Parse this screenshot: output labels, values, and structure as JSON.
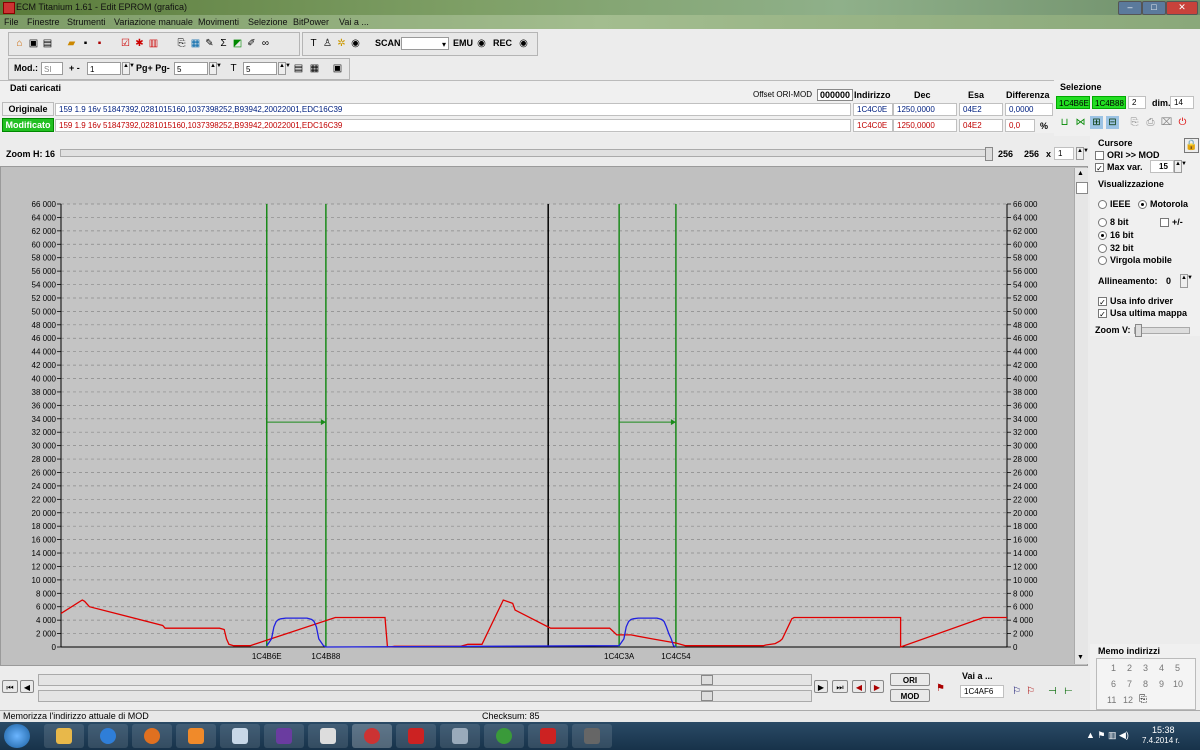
{
  "window": {
    "title": "ECM Titanium 1.61 - Edit EPROM (grafica)",
    "min_icon": "minimize-icon",
    "max_icon": "maximize-icon",
    "close_icon": "close-icon"
  },
  "menu": [
    "File",
    "Finestre",
    "Strumenti",
    "Variazione manuale",
    "Movimenti",
    "Selezione",
    "BitPower",
    "Vai a ..."
  ],
  "toolbar": {
    "scan_label": "SCAN",
    "emu_label": "EMU",
    "rec_label": "REC"
  },
  "toolbar2": {
    "mod_label": "Mod.:",
    "mod_value": "SI",
    "plusminus_label": "+ -",
    "plusminus_value": "1",
    "pg_label": "Pg+ Pg-",
    "pg_value": "5",
    "t_value": "5"
  },
  "data": {
    "section_title": "Dati caricati",
    "offset_label": "Offset ORI-MOD",
    "offset_value": "000000",
    "col_indirizzo": "Indirizzo",
    "col_dec": "Dec",
    "col_esa": "Esa",
    "col_diff": "Differenza",
    "originale": {
      "label": "Originale",
      "desc": "159 1.9 16v 51847392,0281015160,1037398252,B93942,20022001,EDC16C39",
      "indirizzo": "1C4C0E",
      "dec": "1250,0000",
      "esa": "04E2",
      "diff": "0,0000"
    },
    "modificato": {
      "label": "Modificato",
      "desc": "159 1.9 16v 51847392,0281015160,1037398252,B93942,20022001,EDC16C39",
      "indirizzo": "1C4C0E",
      "dec": "1250,0000",
      "esa": "04E2",
      "diff": "0,0",
      "diff_unit": "%"
    }
  },
  "selezione": {
    "title": "Selezione",
    "start": "1C4B6E",
    "end": "1C4B88",
    "count": "2",
    "dim_label": "dim.",
    "dim_value": "14"
  },
  "zoom": {
    "label": "Zoom H: 16",
    "v1": "256",
    "v2": "256",
    "x": "x",
    "mult": "1"
  },
  "cursore": {
    "title": "Cursore",
    "ori_mod": "ORI >> MOD",
    "max_var_label": "Max var.",
    "max_var_value": "15"
  },
  "visualizzazione": {
    "title": "Visualizzazione",
    "ieee": "IEEE",
    "motorola": "Motorola",
    "bit8": "8 bit",
    "plusminus": "+/-",
    "bit16": "16 bit",
    "bit32": "32 bit",
    "virgola": "Virgola mobile",
    "allineamento_label": "Allineamento:",
    "allineamento_value": "0",
    "usa_info": "Usa info driver",
    "usa_ultima": "Usa ultima mappa",
    "zoomv": "Zoom V:"
  },
  "memo": {
    "title": "Memo indirizzi",
    "nums": [
      "1",
      "2",
      "3",
      "4",
      "5",
      "6",
      "7",
      "8",
      "9",
      "10",
      "11",
      "12"
    ]
  },
  "bottom": {
    "ori": "ORI",
    "mod": "MOD",
    "vai_label": "Vai a ...",
    "vai_value": "1C4AF6"
  },
  "status": {
    "left": "Memorizza l'indirizzo attuale di MOD",
    "checksum": "Checksum: 85"
  },
  "clock": {
    "time": "15:38",
    "date": "7.4.2014 r."
  },
  "chart_data": {
    "type": "line",
    "y_ticks": [
      "0",
      "2 000",
      "4 000",
      "6 000",
      "8 000",
      "10 000",
      "12 000",
      "14 000",
      "16 000",
      "18 000",
      "20 000",
      "22 000",
      "24 000",
      "26 000",
      "28 000",
      "30 000",
      "32 000",
      "34 000",
      "36 000",
      "38 000",
      "40 000",
      "42 000",
      "44 000",
      "46 000",
      "48 000",
      "50 000",
      "52 000",
      "54 000",
      "56 000",
      "58 000",
      "60 000",
      "62 000",
      "64 000",
      "66 000"
    ],
    "ylim": [
      0,
      66000
    ],
    "grid": true,
    "x_markers": [
      "1C4B6E",
      "1C4B88",
      "1C4C3A",
      "1C4C54"
    ],
    "series": [
      {
        "color": "#e00000",
        "x": [
          0,
          9,
          10,
          12,
          43,
          44,
          46,
          67,
          69,
          70,
          71,
          73,
          77,
          78,
          80,
          116,
          118,
          123,
          124,
          126,
          134,
          137,
          138,
          139,
          141,
          167,
          169,
          172,
          178,
          187,
          191,
          192,
          207,
          213,
          216,
          219,
          225,
          231,
          232,
          235,
          237,
          241,
          250,
          260,
          263,
          264,
          297,
          298,
          302,
          304,
          305,
          309,
          310,
          311,
          312,
          344,
          346,
          354,
          355,
          355,
          390,
          400
        ],
        "y": [
          5000,
          7000,
          6800,
          6000,
          3200,
          2800,
          2800,
          2800,
          2600,
          1200,
          400,
          200,
          200,
          200,
          200,
          4400,
          4400,
          4400,
          4400,
          4400,
          4400,
          4400,
          100,
          0,
          100,
          100,
          100,
          400,
          400,
          7000,
          6500,
          5500,
          2800,
          2800,
          2800,
          2800,
          2800,
          2800,
          2800,
          1800,
          1800,
          1800,
          1200,
          600,
          300,
          200,
          200,
          300,
          500,
          900,
          1200,
          4200,
          4400,
          4400,
          4400,
          4400,
          4400,
          4400,
          4400,
          0,
          4400,
          4400
        ]
      },
      {
        "color": "#2020e0",
        "x": [
          87,
          89,
          90,
          91,
          92,
          93,
          95,
          104,
          105,
          106,
          107,
          108,
          109,
          111,
          112,
          236,
          238,
          239,
          240,
          241,
          242,
          244,
          252,
          253,
          254,
          255,
          256,
          257,
          258,
          259,
          260
        ],
        "y": [
          200,
          1200,
          3000,
          3800,
          4100,
          4200,
          4300,
          4300,
          4200,
          4100,
          3800,
          3000,
          1200,
          200,
          0,
          200,
          1200,
          3000,
          3800,
          4100,
          4200,
          4300,
          4300,
          4200,
          4100,
          3800,
          3000,
          2000,
          1200,
          200,
          0
        ]
      }
    ]
  }
}
